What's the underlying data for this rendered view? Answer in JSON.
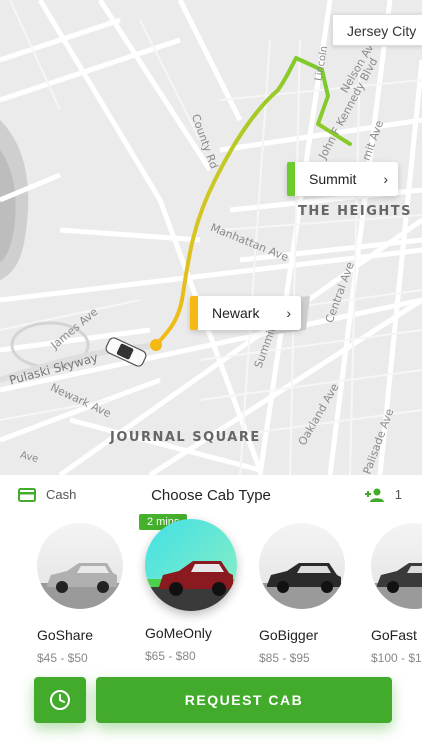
{
  "map": {
    "city_chip": "Jersey City",
    "labels": {
      "county_rd": "County Rd",
      "manhattan_ave": "Manhattan Ave",
      "central_ave": "Central Ave",
      "summit_ave": "Summit Ave",
      "james_ave": "James Ave",
      "pulaski": "Pulaski Skyway",
      "newark_ave": "Newark Ave",
      "oakland_ave": "Oakland Ave",
      "palisade_ave": "Palisade Ave",
      "lincoln": "Lincoln",
      "john_f_kennedy": "John F Kennedy Blvd",
      "nelson": "Nelson Av",
      "mit_ave": "mit Ave",
      "ave_small": "Ave"
    },
    "districts": {
      "heights": "THE HEIGHTS",
      "journal_square": "JOURNAL SQUARE"
    },
    "destination": {
      "label": "Summit",
      "color": "#6ccb2e"
    },
    "origin": {
      "label": "Newark",
      "color": "#f5b914"
    }
  },
  "panel": {
    "payment_label": "Cash",
    "title": "Choose Cab Type",
    "passengers": "1",
    "eta_badge": "2 mins",
    "cabs": [
      {
        "name": "GoShare",
        "price": "$45 - $50",
        "car_color": "#b0b0b0"
      },
      {
        "name": "GoMeOnly",
        "price": "$65 - $80",
        "car_color": "#8a1a1f"
      },
      {
        "name": "GoBigger",
        "price": "$85 - $95",
        "car_color": "#2a2a2a"
      },
      {
        "name": "GoFast",
        "price": "$100 - $1",
        "car_color": "#3a3a3a"
      }
    ],
    "request_button": "REQUEST CAB"
  },
  "colors": {
    "accent": "#43ab2c",
    "route_start": "#f5b914",
    "route_end": "#6ccb2e"
  }
}
